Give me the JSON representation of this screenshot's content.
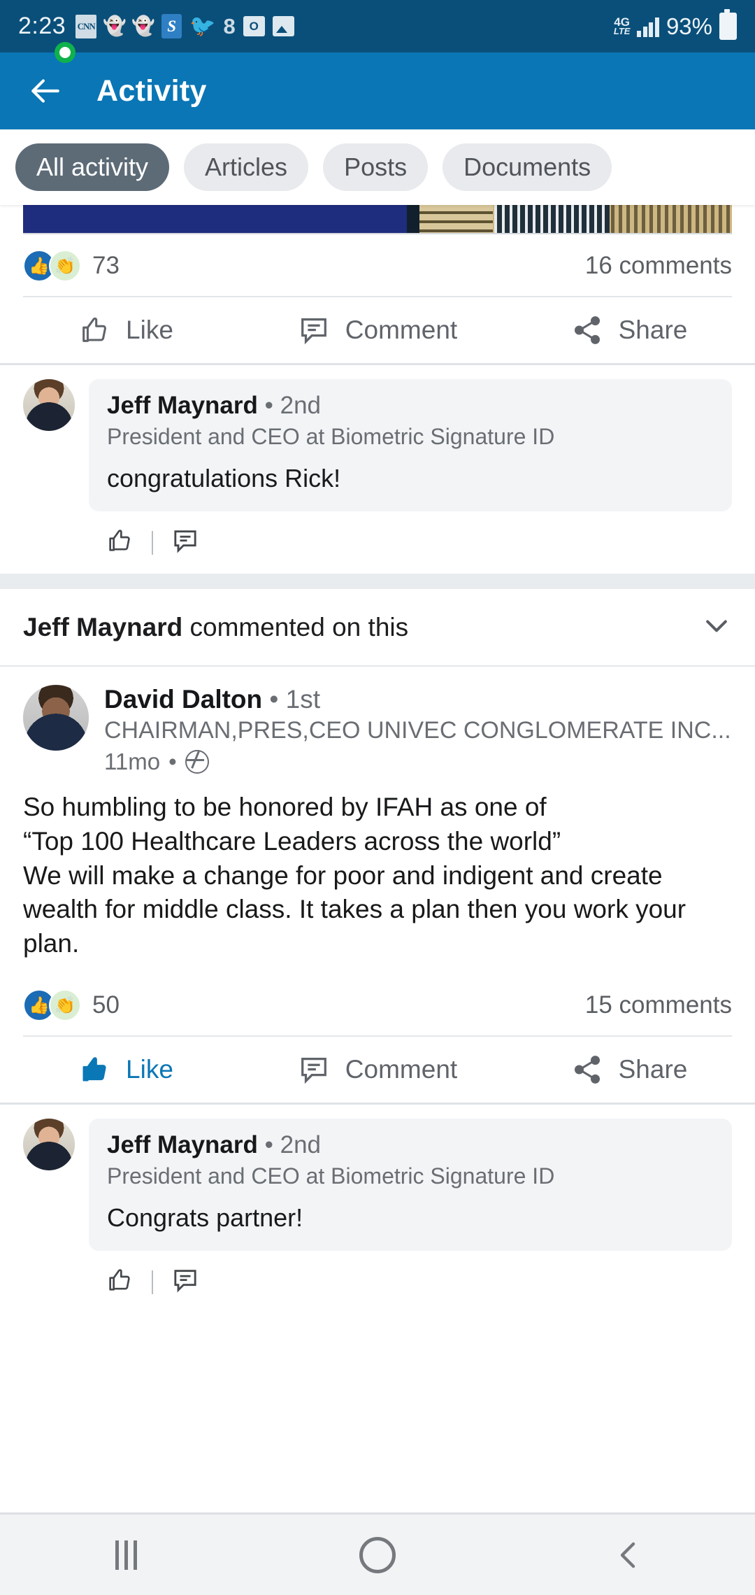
{
  "status_bar": {
    "time": "2:23",
    "icons_left": [
      "cnn-icon",
      "snapchat-ghost-icon",
      "snapchat-ghost-icon",
      "skype-icon",
      "twitter-icon",
      "eight-badge-icon",
      "outlook-icon",
      "photos-icon"
    ],
    "network_label": "4G",
    "network_sub": "LTE",
    "battery_percent": "93%"
  },
  "app_bar": {
    "back_label": "back-arrow",
    "title": "Activity"
  },
  "tabs": [
    {
      "label": "All activity",
      "active": true
    },
    {
      "label": "Articles",
      "active": false
    },
    {
      "label": "Posts",
      "active": false
    },
    {
      "label": "Documents",
      "active": false
    }
  ],
  "post_top": {
    "reaction_count": "73",
    "comment_count": "16 comments",
    "actions": [
      {
        "label": "Like",
        "icon": "thumbs-up-icon",
        "liked": false
      },
      {
        "label": "Comment",
        "icon": "comment-icon",
        "liked": false
      },
      {
        "label": "Share",
        "icon": "share-icon",
        "liked": false
      }
    ]
  },
  "comment_top": {
    "author": "Jeff Maynard",
    "degree": "• 2nd",
    "headline": "President and CEO at Biometric Signature ID",
    "text": "congratulations Rick!",
    "like_icon": "thumbs-up-icon",
    "reply_icon": "comment-icon"
  },
  "section_header": {
    "actor": "Jeff Maynard",
    "action": " commented on this",
    "chevron": "chevron-down-icon"
  },
  "post_main": {
    "author": "David Dalton",
    "degree": "• 1st",
    "headline": "CHAIRMAN,PRES,CEO UNIVEC CONGLOMERATE INC...",
    "time": "11mo",
    "visibility_icon": "globe-icon",
    "body": "So humbling to be honored by IFAH as one of\n“Top 100 Healthcare Leaders across the world”\nWe will make a change for poor and indigent and create wealth for middle class. It takes a plan then you work your plan.",
    "reaction_count": "50",
    "comment_count": "15 comments",
    "actions": [
      {
        "label": "Like",
        "icon": "thumbs-up-icon",
        "liked": true
      },
      {
        "label": "Comment",
        "icon": "comment-icon",
        "liked": false
      },
      {
        "label": "Share",
        "icon": "share-icon",
        "liked": false
      }
    ]
  },
  "comment_bottom": {
    "author": "Jeff Maynard",
    "degree": "• 2nd",
    "headline": "President and CEO at Biometric Signature ID",
    "text": "Congrats partner!",
    "like_icon": "thumbs-up-icon",
    "reply_icon": "comment-icon"
  },
  "nav_bar": {
    "recents": "recents-icon",
    "home": "home-icon",
    "back": "back-icon"
  },
  "colors": {
    "status_bar": "#0a4f7a",
    "app_bar": "#0a76b5",
    "accent": "#0a77b6",
    "active_pill": "#5d6b77"
  }
}
